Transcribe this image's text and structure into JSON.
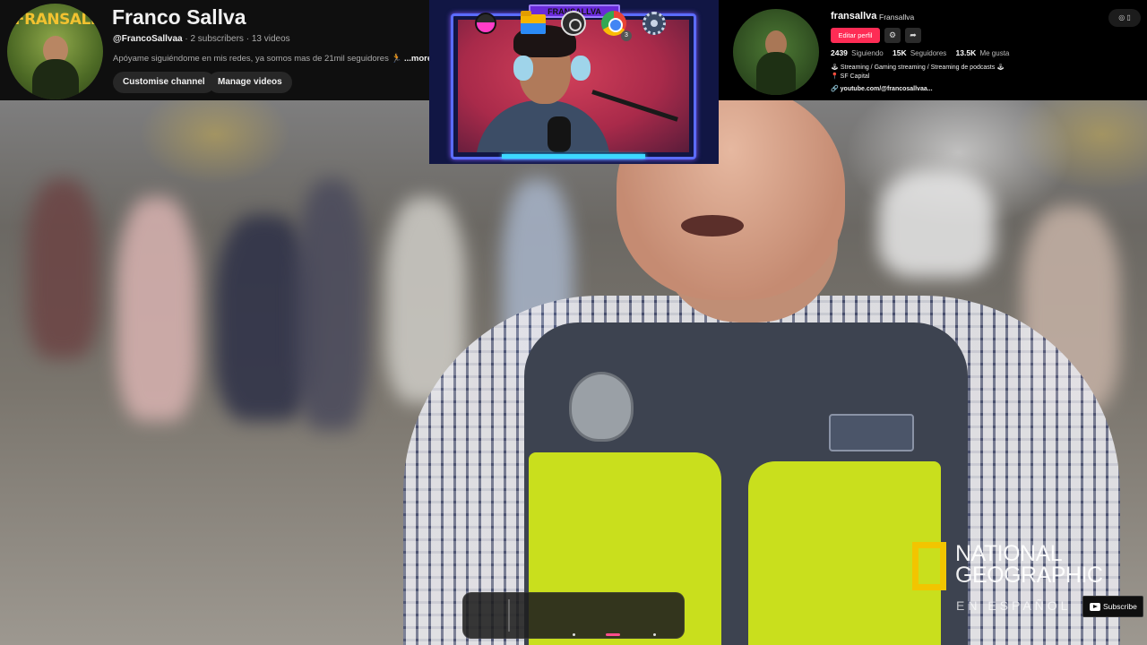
{
  "youtube": {
    "channel_name": "Franco Sallva",
    "avatar_text": "FRANSALLVA",
    "handle": "@FrancoSallvaa",
    "meta_rest": " · 2 subscribers · 13 videos",
    "description": "Apóyame siguiéndome en mis redes, ya somos mas de 21mil seguidores 🏃 ",
    "more_label": "...more",
    "customise_button": "Customise channel",
    "manage_button": "Manage videos"
  },
  "webcam": {
    "title": "FRANSALLVA"
  },
  "tiktok": {
    "username": "fransallva",
    "nickname": "Fransallva",
    "edit_button": "Editar perfil",
    "settings_icon": "⚙",
    "share_icon": "➦",
    "following_count": "2439",
    "following_label": "Siguiendo",
    "followers_count": "15K",
    "followers_label": "Seguidores",
    "likes_count": "13.5K",
    "likes_label": "Me gusta",
    "bio_line1": "🕹 Streaming / Gaming streaming / Streaming de podcasts 🕹",
    "bio_line2": "📍 SF Capital",
    "link": "🔗 youtube.com/@francosallvaa...",
    "corner_icons": "◎ ▯"
  },
  "video": {
    "watermark_line1": "NATIONAL",
    "watermark_line2": "GEOGRAPHIC",
    "watermark_sub": "EN ESPAÑOL",
    "subscribe_label": "Subscribe"
  },
  "dock": {
    "chrome_badge": "3"
  },
  "colors": {
    "youtube_bg": "#0f0f0f",
    "tiktok_accent": "#fe2c55",
    "natgeo_yellow": "#f2c500",
    "webcam_border": "#5b6cff"
  }
}
